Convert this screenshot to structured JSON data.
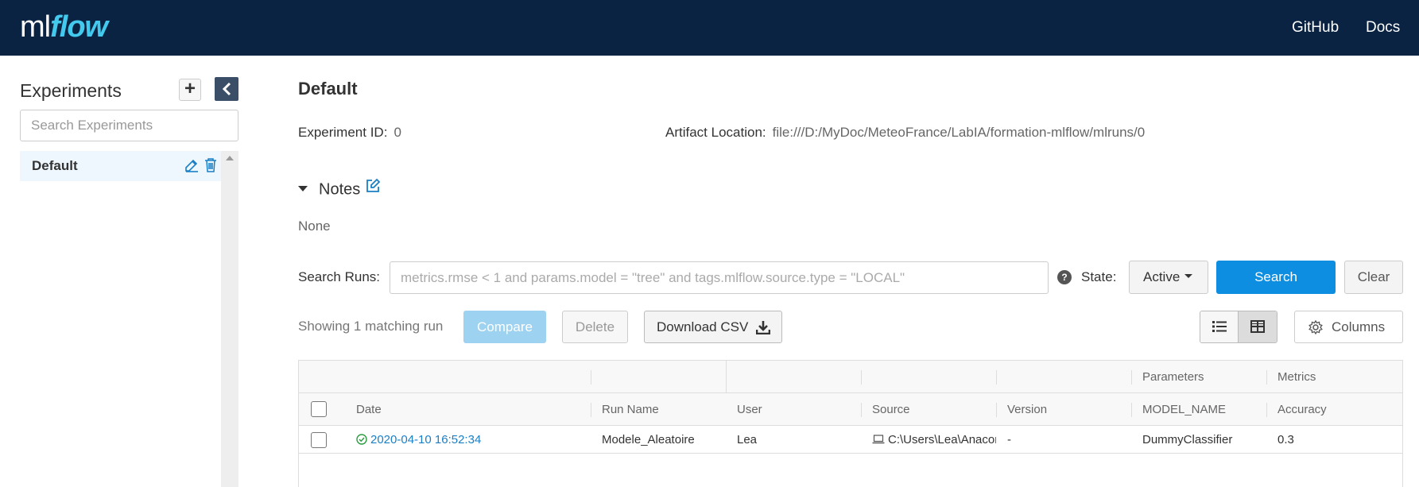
{
  "header": {
    "logo_ml": "ml",
    "logo_flow": "flow",
    "links": [
      {
        "label": "GitHub"
      },
      {
        "label": "Docs"
      }
    ],
    "background": "#0a2342",
    "logo_accent": "#43c9ed"
  },
  "sidebar": {
    "title": "Experiments",
    "add_label": "+",
    "search_placeholder": "Search Experiments",
    "experiments": [
      {
        "name": "Default",
        "selected": true
      }
    ]
  },
  "experiment": {
    "title": "Default",
    "id_label": "Experiment ID:",
    "id_value": "0",
    "artifact_label": "Artifact Location:",
    "artifact_value": "file:///D:/MyDoc/MeteoFrance/LabIA/formation-mlflow/mlruns/0",
    "notes_label": "Notes",
    "notes_value": "None"
  },
  "search": {
    "label": "Search Runs:",
    "placeholder": "metrics.rmse < 1 and params.model = \"tree\" and tags.mlflow.source.type = \"LOCAL\"",
    "help": "?",
    "state_label": "State:",
    "state_value": "Active",
    "search_button": "Search",
    "clear_button": "Clear",
    "primary_color": "#0d8ee0"
  },
  "toolbar": {
    "showing": "Showing 1 matching run",
    "compare": "Compare",
    "delete": "Delete",
    "download_csv": "Download CSV",
    "columns": "Columns"
  },
  "table": {
    "group_headers": {
      "parameters": "Parameters",
      "metrics": "Metrics"
    },
    "columns": [
      "Date",
      "Run Name",
      "User",
      "Source",
      "Version",
      "MODEL_NAME",
      "Accuracy"
    ],
    "rows": [
      {
        "date": "2020-04-10 16:52:34",
        "run_name": "Modele_Aleatoire",
        "user": "Lea",
        "source": "C:\\Users\\Lea\\Anaconda",
        "version": "-",
        "model_name": "DummyClassifier",
        "accuracy": "0.3",
        "status": "success"
      }
    ]
  }
}
